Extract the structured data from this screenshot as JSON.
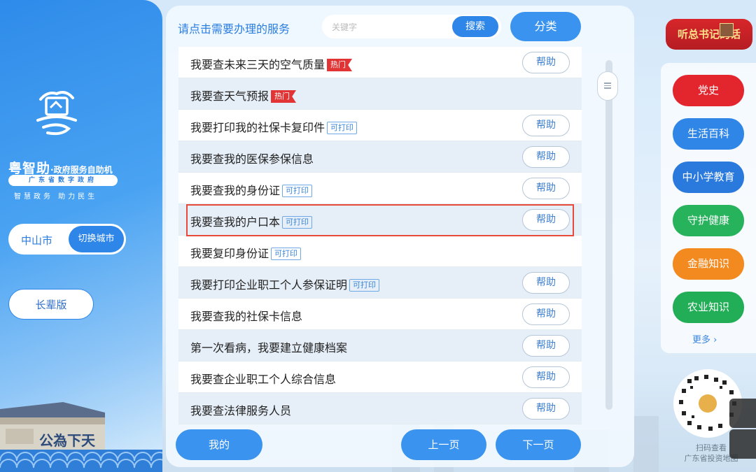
{
  "left": {
    "brand_name": "粤智助",
    "brand_suffix": "·政府服务自助机",
    "gov_badge": "广东省数字政府",
    "slogan": "智慧政务 助力民生",
    "city": "中山市",
    "switch_city": "切换城市",
    "elder_mode": "长辈版",
    "building_text": "公為下天"
  },
  "center": {
    "prompt": "请点击需要办理的服务",
    "search_placeholder": "关键字",
    "search_button": "搜索",
    "category_button": "分类",
    "tags": {
      "hot": "热门",
      "printable": "可打印"
    },
    "help_label": "帮助",
    "services": [
      {
        "label": "我要查未来三天的空气质量",
        "tag": "hot",
        "help": true
      },
      {
        "label": "我要查天气预报",
        "tag": "hot",
        "help": false
      },
      {
        "label": "我要打印我的社保卡复印件",
        "tag": "printable",
        "help": true
      },
      {
        "label": "我要查我的医保参保信息",
        "tag": "",
        "help": true
      },
      {
        "label": "我要查我的身份证",
        "tag": "printable",
        "help": true
      },
      {
        "label": "我要查我的户口本",
        "tag": "printable",
        "help": true,
        "highlighted": true
      },
      {
        "label": "我要复印身份证",
        "tag": "printable",
        "help": false
      },
      {
        "label": "我要打印企业职工个人参保证明",
        "tag": "printable",
        "help": true
      },
      {
        "label": "我要查我的社保卡信息",
        "tag": "",
        "help": true
      },
      {
        "label": "第一次看病，我要建立健康档案",
        "tag": "",
        "help": true
      },
      {
        "label": "我要查企业职工个人综合信息",
        "tag": "",
        "help": true
      },
      {
        "label": "我要查法律服务人员",
        "tag": "",
        "help": true
      }
    ],
    "bottom": {
      "mine": "我的",
      "prev": "上一页",
      "next": "下一页"
    }
  },
  "right": {
    "speech_button": "听总书记的话",
    "categories": [
      {
        "label": "党史",
        "color": "#e3262e"
      },
      {
        "label": "生活百科",
        "color": "#2f86e6"
      },
      {
        "label": "中小学教育",
        "color": "#2a79dc"
      },
      {
        "label": "守护健康",
        "color": "#27b35c"
      },
      {
        "label": "金融知识",
        "color": "#f38a1f"
      },
      {
        "label": "农业知识",
        "color": "#22ad57"
      }
    ],
    "more": "更多 ›",
    "qr_caption_1": "扫码查看",
    "qr_caption_2": "广东省投资地图"
  }
}
